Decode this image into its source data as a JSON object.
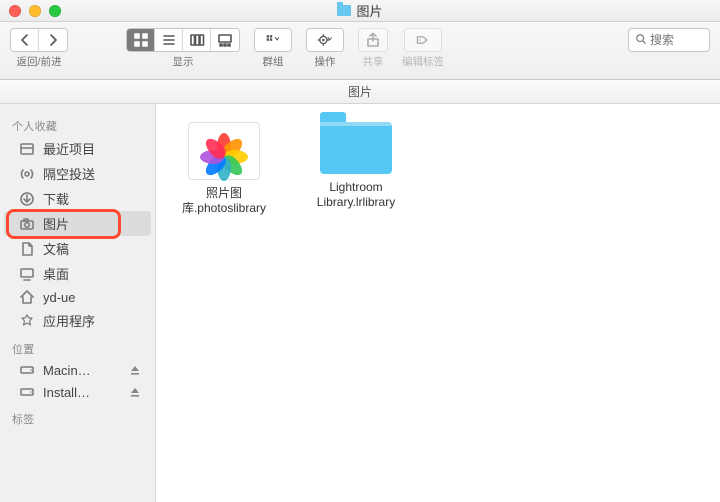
{
  "window": {
    "title": "图片"
  },
  "toolbar": {
    "nav_label": "返回/前进",
    "view_label": "显示",
    "group_label": "群组",
    "action_label": "操作",
    "share_label": "共享",
    "tags_label": "编辑标签"
  },
  "locbar": {
    "path": "图片"
  },
  "search": {
    "placeholder": "搜索"
  },
  "sidebar": {
    "sections": [
      {
        "header": "个人收藏",
        "items": [
          {
            "label": "最近项目"
          },
          {
            "label": "隔空投送"
          },
          {
            "label": "下载"
          },
          {
            "label": "图片",
            "selected": true
          },
          {
            "label": "文稿"
          },
          {
            "label": "桌面"
          },
          {
            "label": "yd-ue"
          },
          {
            "label": "应用程序"
          }
        ]
      },
      {
        "header": "位置",
        "items": [
          {
            "label": "Macin…",
            "ejectable": true
          },
          {
            "label": "Install…",
            "ejectable": true
          }
        ]
      },
      {
        "header": "标签",
        "items": []
      }
    ]
  },
  "content": {
    "items": [
      {
        "name_line1": "照片图",
        "name_line2": "库.photoslibrary",
        "kind": "photoslibrary"
      },
      {
        "name_line1": "Lightroom",
        "name_line2": "Library.lrlibrary",
        "kind": "folder"
      }
    ]
  }
}
